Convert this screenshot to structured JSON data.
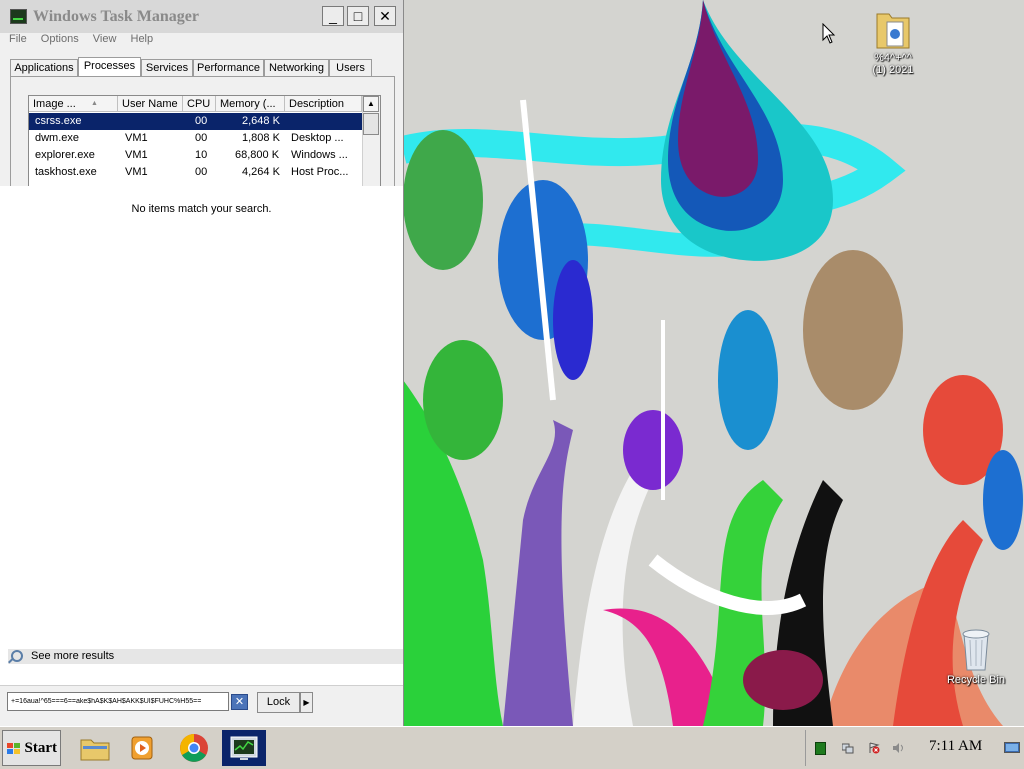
{
  "desktop": {
    "icons": [
      {
        "name": "folder",
        "label_line1": "%4^+^^",
        "label_line2": "(1) 2021"
      },
      {
        "name": "recycle-bin",
        "label": "Recycle Bin"
      }
    ]
  },
  "taskmgr": {
    "title": "Windows Task Manager",
    "window_buttons": {
      "minimize": "_",
      "maximize": "□",
      "close": "✕"
    },
    "menu": [
      "File",
      "Options",
      "View",
      "Help"
    ],
    "tabs": [
      "Applications",
      "Processes",
      "Services",
      "Performance",
      "Networking",
      "Users"
    ],
    "active_tab": "Processes",
    "columns": [
      "Image ...",
      "User Name",
      "CPU",
      "Memory (...",
      "Description"
    ],
    "sort_indicator": "▲",
    "processes": [
      {
        "image": "csrss.exe",
        "user": "",
        "cpu": "00",
        "memory": "2,648 K",
        "description": ""
      },
      {
        "image": "dwm.exe",
        "user": "VM1",
        "cpu": "00",
        "memory": "1,808 K",
        "description": "Desktop ..."
      },
      {
        "image": "explorer.exe",
        "user": "VM1",
        "cpu": "10",
        "memory": "68,800 K",
        "description": "Windows ..."
      },
      {
        "image": "taskhost.exe",
        "user": "VM1",
        "cpu": "00",
        "memory": "4,264 K",
        "description": "Host Proc..."
      }
    ]
  },
  "start_search": {
    "no_results": "No items match your search.",
    "see_more": "See more results",
    "query": "+=16aua!^65===6==ake$hA$K$AH$AKK$UI$FUHC%H55==",
    "lock_label": "Lock",
    "lock_arrow": "▶",
    "clear_glyph": "✕"
  },
  "taskbar": {
    "start_label": "Start",
    "pinned": [
      "windows-explorer",
      "media-player",
      "chrome",
      "task-manager"
    ],
    "active_item": "task-manager",
    "clock": "7:11 AM"
  }
}
